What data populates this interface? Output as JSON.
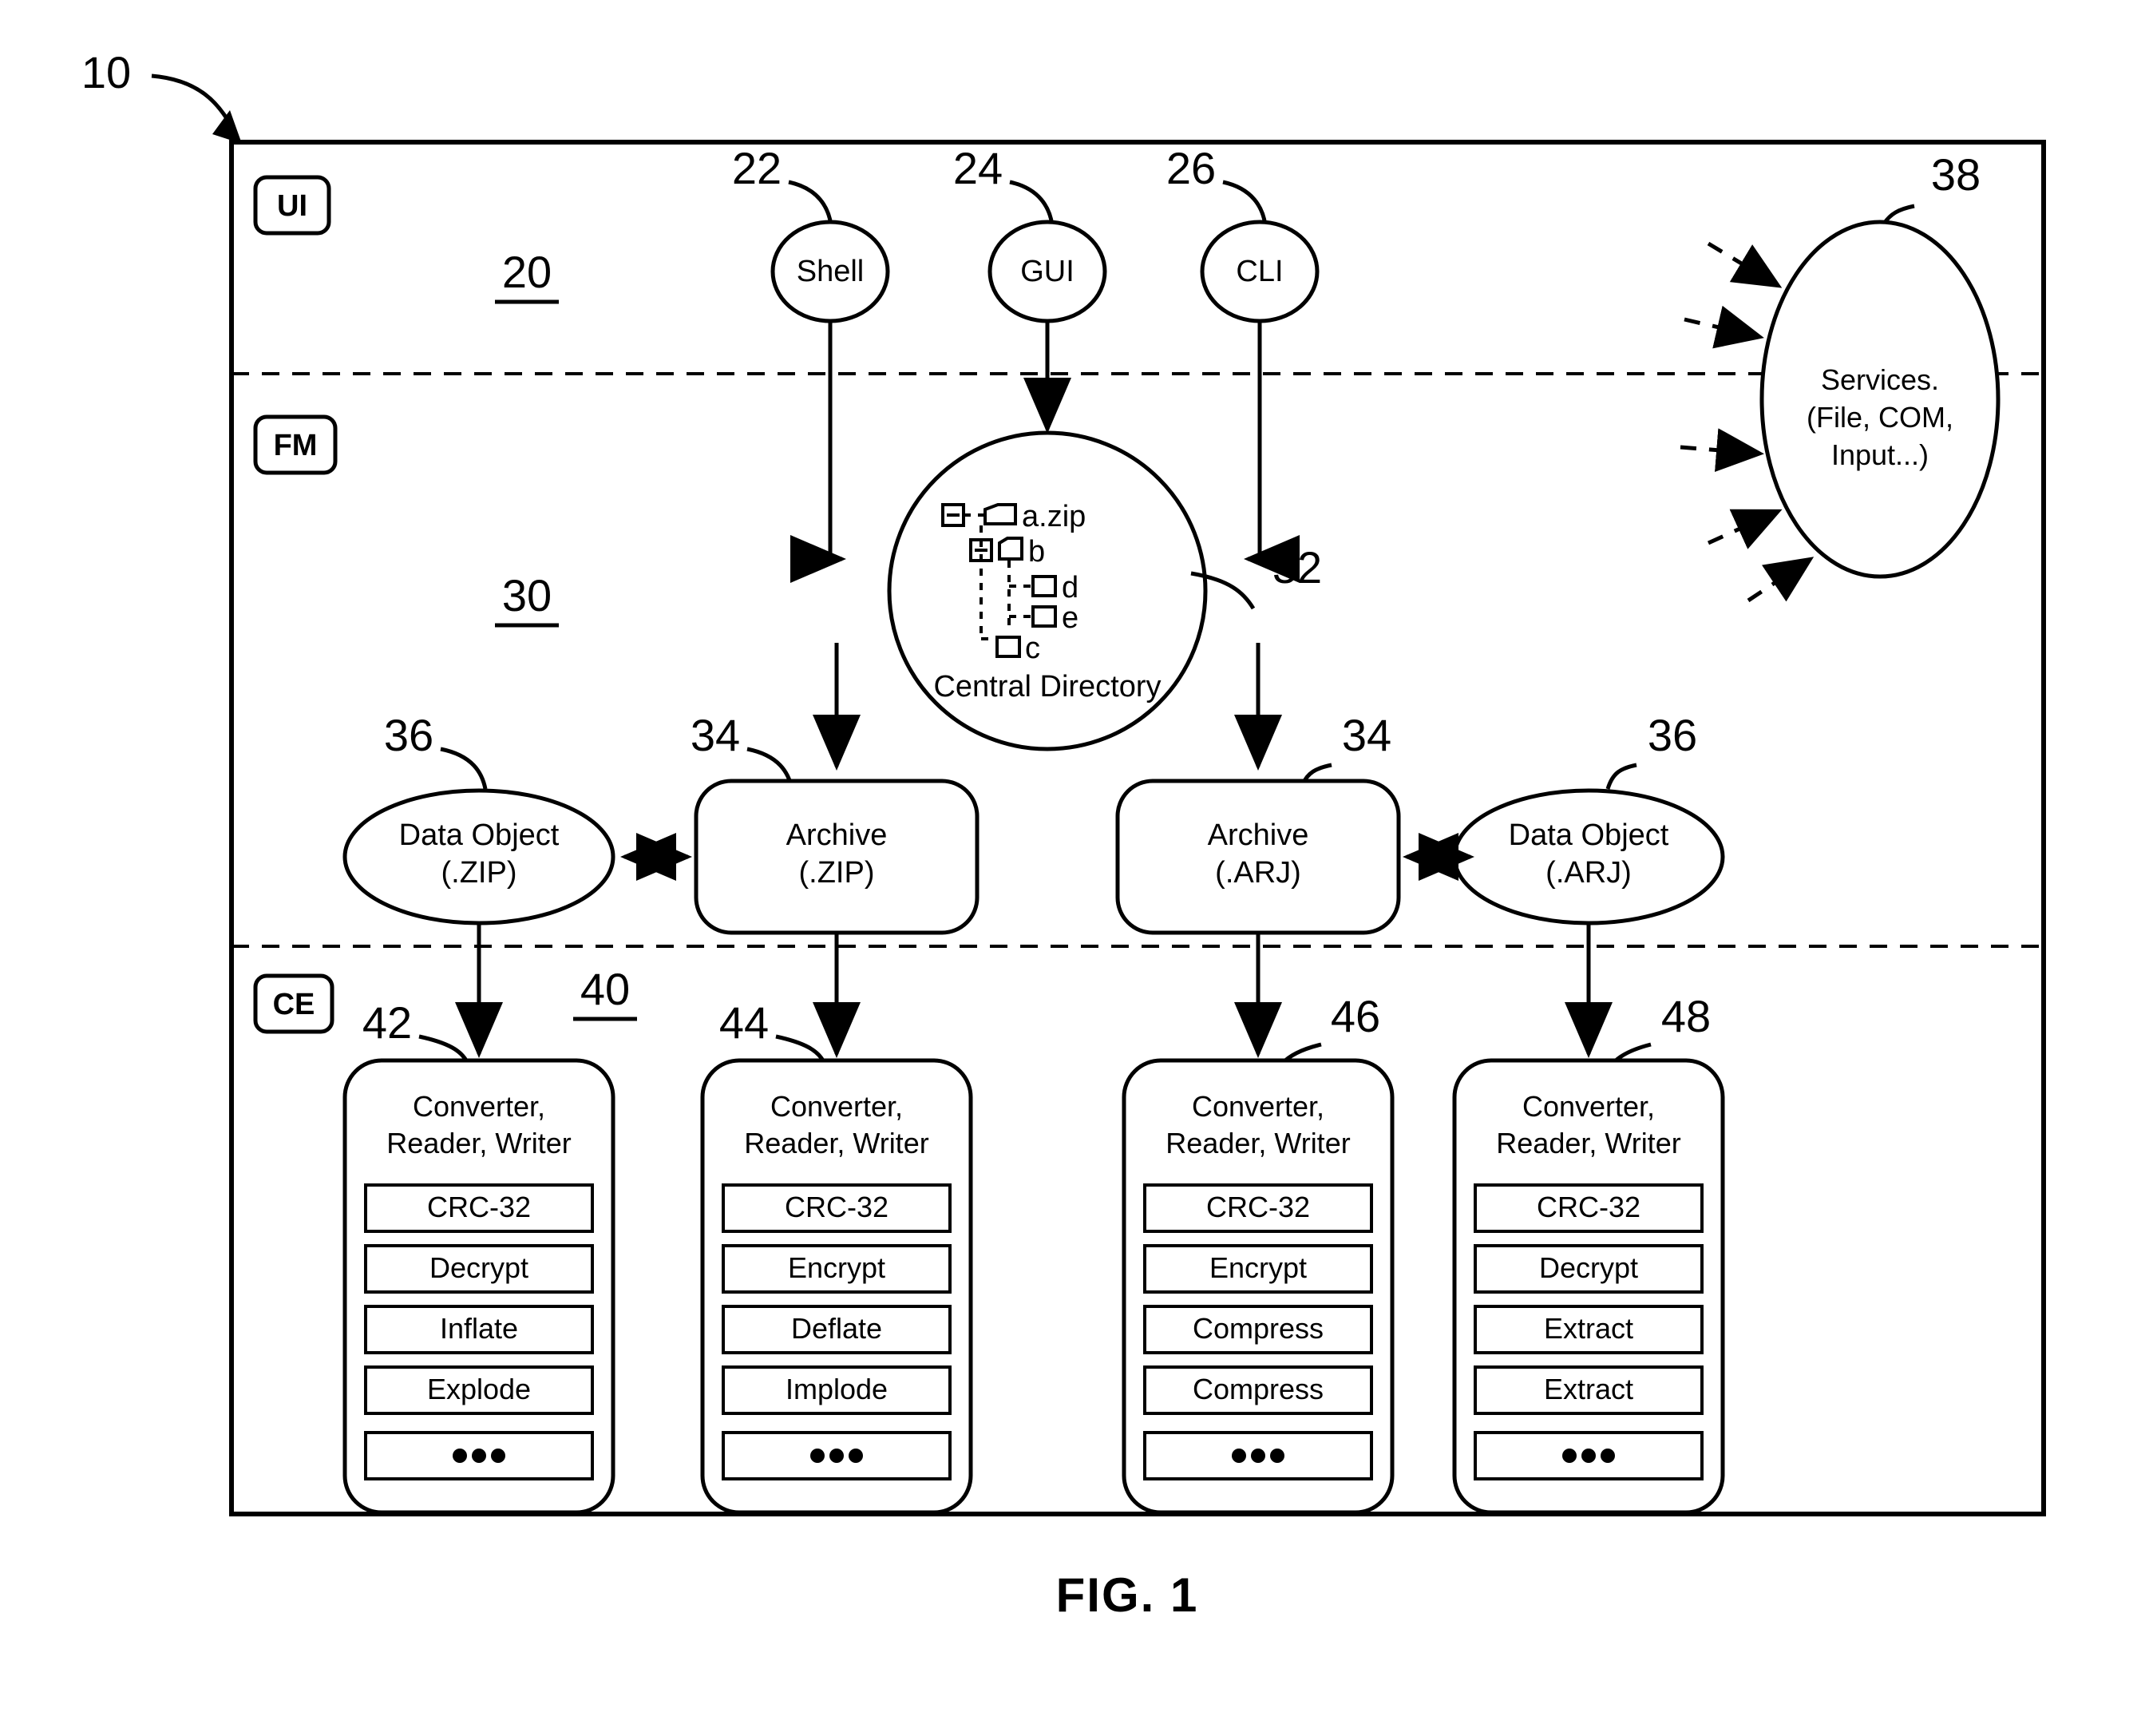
{
  "figure": {
    "caption": "FIG. 1",
    "system_ref": "10"
  },
  "layers": [
    {
      "tag": "UI",
      "ref": "20"
    },
    {
      "tag": "FM",
      "ref": "30"
    },
    {
      "tag": "CE",
      "ref": "40"
    }
  ],
  "ui_nodes": [
    {
      "ref": "22",
      "label": "Shell"
    },
    {
      "ref": "24",
      "label": "GUI"
    },
    {
      "ref": "26",
      "label": "CLI"
    }
  ],
  "services": {
    "ref": "38",
    "line1": "Services.",
    "line2": "(File, COM,",
    "line3": "Input...)",
    "incoming_arrow_count": 5
  },
  "central_directory": {
    "ref": "32",
    "caption": "Central Directory",
    "tree": [
      {
        "label": "a.zip",
        "depth": 0,
        "expander": "minus",
        "icon": "open-folder-icon"
      },
      {
        "label": "b",
        "depth": 1,
        "expander": "minus",
        "icon": "folder-icon"
      },
      {
        "label": "d",
        "depth": 2,
        "expander": "none",
        "icon": "folder-icon"
      },
      {
        "label": "e",
        "depth": 2,
        "expander": "none",
        "icon": "folder-icon"
      },
      {
        "label": "c",
        "depth": 1,
        "expander": "none",
        "icon": "folder-icon"
      }
    ]
  },
  "fm_nodes": [
    {
      "ref": "36",
      "shape": "ellipse",
      "line1": "Data Object",
      "line2": "(.ZIP)"
    },
    {
      "ref": "34",
      "shape": "rounded-rect",
      "line1": "Archive",
      "line2": "(.ZIP)"
    },
    {
      "ref": "34",
      "shape": "rounded-rect",
      "line1": "Archive",
      "line2": "(.ARJ)"
    },
    {
      "ref": "36",
      "shape": "ellipse",
      "line1": "Data Object",
      "line2": "(.ARJ)"
    }
  ],
  "converters": [
    {
      "ref": "42",
      "title_line1": "Converter,",
      "title_line2": "Reader, Writer",
      "items": [
        "CRC-32",
        "Decrypt",
        "Inflate",
        "Explode",
        "..."
      ]
    },
    {
      "ref": "44",
      "title_line1": "Converter,",
      "title_line2": "Reader, Writer",
      "items": [
        "CRC-32",
        "Encrypt",
        "Deflate",
        "Implode",
        "..."
      ]
    },
    {
      "ref": "46",
      "title_line1": "Converter,",
      "title_line2": "Reader, Writer",
      "items": [
        "CRC-32",
        "Encrypt",
        "Compress",
        "Compress",
        "..."
      ]
    },
    {
      "ref": "48",
      "title_line1": "Converter,",
      "title_line2": "Reader, Writer",
      "items": [
        "CRC-32",
        "Decrypt",
        "Extract",
        "Extract",
        "..."
      ]
    }
  ],
  "colors": {
    "ink": "#000000",
    "paper": "#ffffff"
  }
}
